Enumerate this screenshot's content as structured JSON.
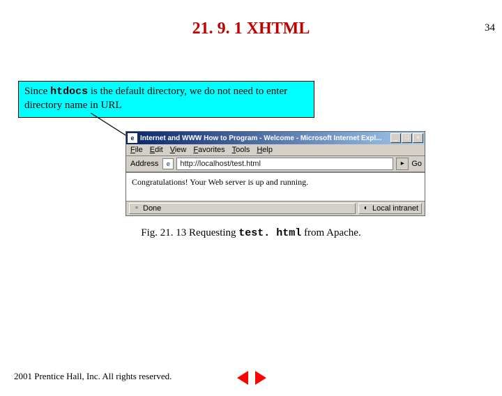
{
  "page_number": "34",
  "section_title": "21. 9. 1 XHTML",
  "callout": {
    "pre": "Since ",
    "code": "htdocs",
    "post": " is the default directory, we do not need to enter directory name in URL"
  },
  "browser": {
    "title": "Internet and WWW How to Program - Welcome - Microsoft Internet Expl...",
    "menus": [
      "File",
      "Edit",
      "View",
      "Favorites",
      "Tools",
      "Help"
    ],
    "address_label": "Address",
    "address_value": "http://localhost/test.html",
    "go_label": "Go",
    "page_text": "Congratulations! Your Web server is up and running.",
    "status_left": "Done",
    "status_right": "Local intranet"
  },
  "caption": {
    "pre": "Fig. 21. 13  Requesting ",
    "code": "test. html",
    "post": " from Apache."
  },
  "footer": " 2001 Prentice Hall, Inc. All rights reserved."
}
